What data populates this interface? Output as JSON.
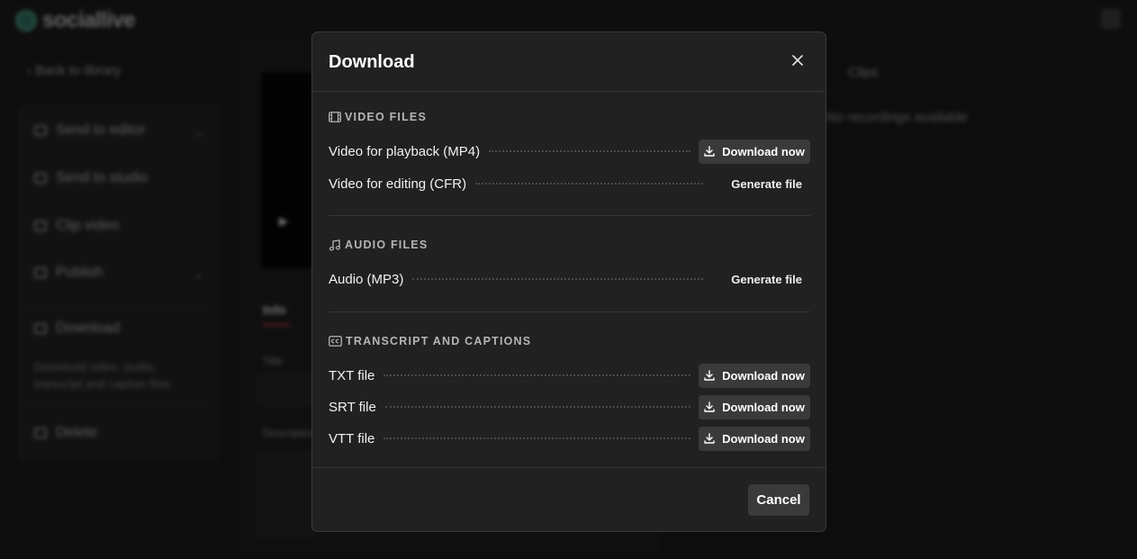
{
  "background": {
    "logo_text": "sociallive",
    "back_link": "Back to library",
    "sidebar": {
      "items": [
        {
          "label": "Send to editor"
        },
        {
          "label": "Send to studio"
        },
        {
          "label": "Clip video"
        },
        {
          "label": "Publish"
        },
        {
          "label": "Download"
        },
        {
          "label": "Delete"
        }
      ],
      "download_description": "Download video, audio, transcript and caption files"
    },
    "info_tab": "Info",
    "field_title_label": "Title",
    "field_description_label": "Description",
    "clips_tab": "Clips",
    "right_message": "No recordings available"
  },
  "modal": {
    "title": "Download",
    "close_label": "×",
    "sections": [
      {
        "title": "VIDEO FILES",
        "icon": "film-icon",
        "rows": [
          {
            "label": "Video for playback (MP4)",
            "action": "Download now",
            "kind": "download"
          },
          {
            "label": "Video for editing (CFR)",
            "action": "Generate file",
            "kind": "generate"
          }
        ]
      },
      {
        "title": "AUDIO FILES",
        "icon": "music-note-icon",
        "rows": [
          {
            "label": "Audio (MP3)",
            "action": "Generate file",
            "kind": "generate"
          }
        ]
      },
      {
        "title": "TRANSCRIPT AND CAPTIONS",
        "icon": "closed-captions-icon",
        "rows": [
          {
            "label": "TXT file",
            "action": "Download now",
            "kind": "download"
          },
          {
            "label": "SRT file",
            "action": "Download now",
            "kind": "download"
          },
          {
            "label": "VTT file",
            "action": "Download now",
            "kind": "download"
          }
        ]
      }
    ],
    "cancel_label": "Cancel"
  },
  "colors": {
    "modal_bg": "#212121",
    "button_bg": "#3a3a3a",
    "accent": "#c23b4a"
  }
}
